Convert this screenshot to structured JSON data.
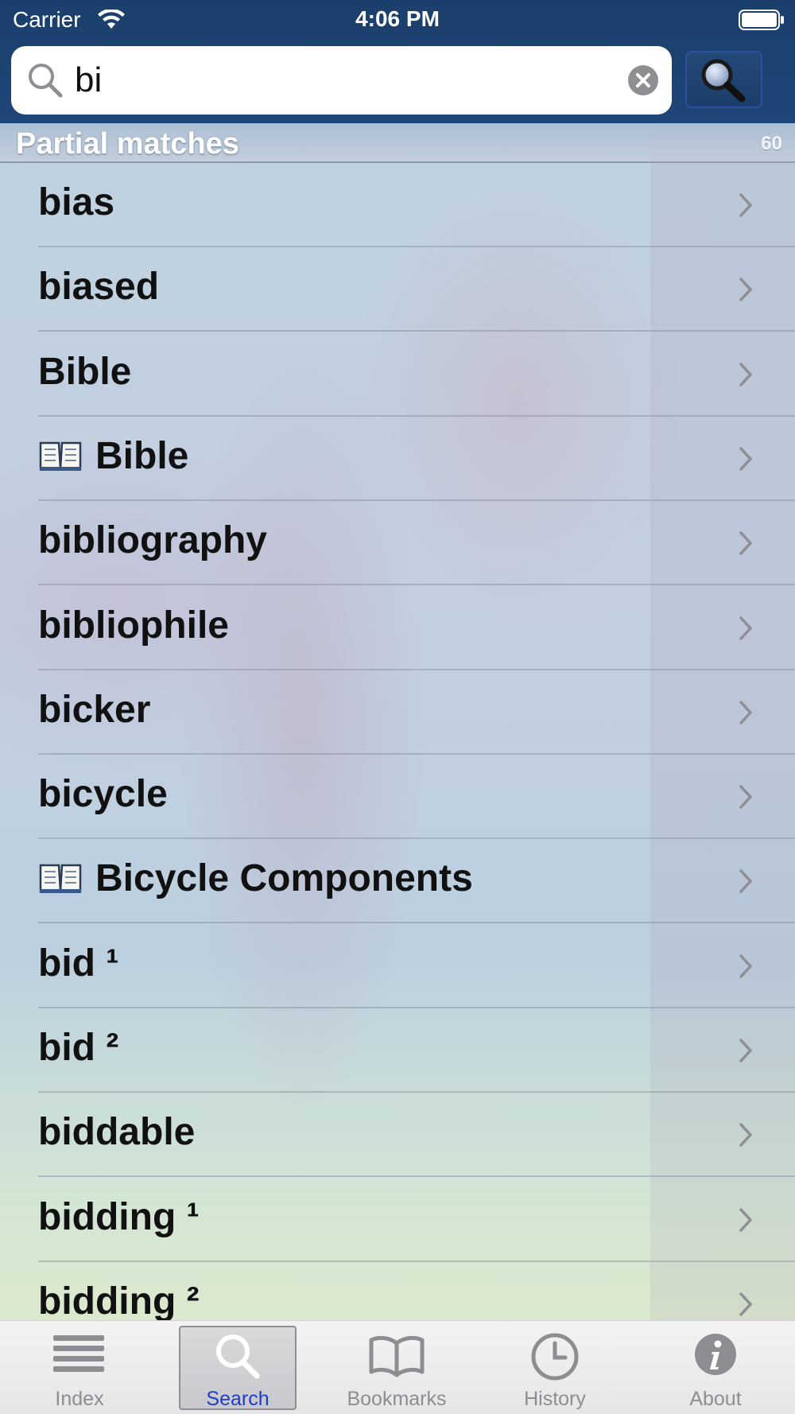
{
  "status": {
    "carrier": "Carrier",
    "time": "4:06 PM"
  },
  "search": {
    "query": "bi",
    "button_icon": "magnifier-icon"
  },
  "section": {
    "title": "Partial matches",
    "count": "60"
  },
  "results": [
    {
      "label": "bias",
      "book": false
    },
    {
      "label": "biased",
      "book": false
    },
    {
      "label": "Bible",
      "book": false
    },
    {
      "label": "Bible",
      "book": true
    },
    {
      "label": "bibliography",
      "book": false
    },
    {
      "label": "bibliophile",
      "book": false
    },
    {
      "label": "bicker",
      "book": false
    },
    {
      "label": "bicycle",
      "book": false
    },
    {
      "label": "Bicycle Components",
      "book": true
    },
    {
      "label": "bid ¹",
      "book": false
    },
    {
      "label": "bid ²",
      "book": false
    },
    {
      "label": "biddable",
      "book": false
    },
    {
      "label": "bidding ¹",
      "book": false
    },
    {
      "label": "bidding ²",
      "book": false
    }
  ],
  "tabs": [
    {
      "label": "Index",
      "icon": "list-icon",
      "selected": false
    },
    {
      "label": "Search",
      "icon": "search-icon",
      "selected": true
    },
    {
      "label": "Bookmarks",
      "icon": "book-icon",
      "selected": false
    },
    {
      "label": "History",
      "icon": "clock-icon",
      "selected": false
    },
    {
      "label": "About",
      "icon": "info-icon",
      "selected": false
    }
  ],
  "colors": {
    "top_bar": "#1b3f6c",
    "selected_tab": "#1d3ec5",
    "tab_text": "#8d8d92"
  }
}
